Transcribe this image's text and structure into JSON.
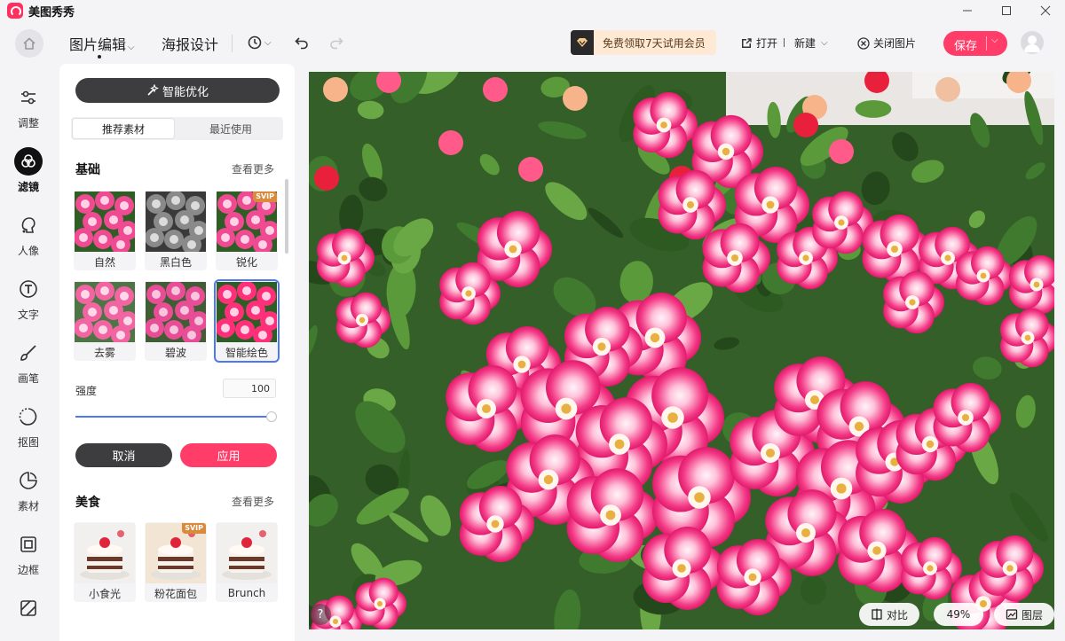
{
  "app": {
    "title": "美图秀秀"
  },
  "toolbar": {
    "image_edit": "图片编辑",
    "poster_design": "海报设计",
    "vip_offer": "免费领取7天试用会员",
    "open": "打开",
    "new": "新建",
    "close_image": "关闭图片",
    "save": "保存"
  },
  "nav": {
    "items": [
      {
        "label": "调整",
        "icon": "sliders-icon"
      },
      {
        "label": "滤镜",
        "icon": "filter-icon",
        "active": true
      },
      {
        "label": "人像",
        "icon": "portrait-icon"
      },
      {
        "label": "文字",
        "icon": "text-icon"
      },
      {
        "label": "画笔",
        "icon": "brush-icon"
      },
      {
        "label": "抠图",
        "icon": "cutout-icon"
      },
      {
        "label": "素材",
        "icon": "sticker-icon"
      },
      {
        "label": "边框",
        "icon": "frame-icon"
      }
    ]
  },
  "panel": {
    "smart_optimize": "智能优化",
    "tabs": [
      "推荐素材",
      "最近使用"
    ],
    "active_tab": 0,
    "basic": {
      "title": "基础",
      "more": "查看更多",
      "filters": [
        {
          "label": "自然",
          "svip": false
        },
        {
          "label": "黑白色",
          "svip": false
        },
        {
          "label": "锐化",
          "svip": true
        },
        {
          "label": "去雾",
          "svip": false
        },
        {
          "label": "碧波",
          "svip": false
        },
        {
          "label": "智能绘色",
          "svip": false,
          "selected": true
        }
      ]
    },
    "strength": {
      "label": "强度",
      "value": "100",
      "level": 100
    },
    "cancel": "取消",
    "apply": "应用",
    "food": {
      "title": "美食",
      "more": "查看更多",
      "filters": [
        {
          "label": "小食光",
          "svip": false
        },
        {
          "label": "粉花面包",
          "svip": true
        },
        {
          "label": "Brunch",
          "svip": false
        }
      ]
    },
    "svip_badge": "SVIP"
  },
  "canvas": {
    "help": "?",
    "compare": "对比",
    "zoom": "49%",
    "layers": "图层"
  },
  "colors": {
    "accent": "#ff3d68",
    "selection": "#4d79f0",
    "dark_button": "#3d3d40"
  }
}
